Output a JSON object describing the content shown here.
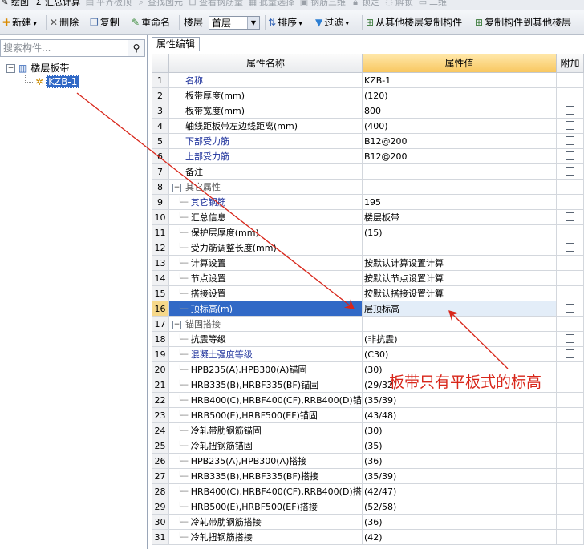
{
  "menu_bar": {
    "items": [
      {
        "icon": "paint-icon",
        "label": "绘图",
        "enabled": true
      },
      {
        "icon": "sigma-icon",
        "label": "汇总计算",
        "enabled": true
      },
      {
        "icon": "align-icon",
        "label": "平齐板顶",
        "enabled": false
      },
      {
        "icon": "find-icon",
        "label": "查找图元",
        "enabled": false
      },
      {
        "icon": "rebar-icon",
        "label": "查看钢筋量",
        "enabled": false
      },
      {
        "icon": "batch-icon",
        "label": "批量选择",
        "enabled": false
      },
      {
        "icon": "3d-icon",
        "label": "钢筋三维",
        "enabled": false
      },
      {
        "icon": "lock-icon",
        "label": "锁定",
        "enabled": false
      },
      {
        "icon": "unlock-icon",
        "label": "解锁",
        "enabled": false
      },
      {
        "icon": "view-icon",
        "label": "二维",
        "enabled": false
      }
    ]
  },
  "toolbar": {
    "new_label": "新建",
    "delete_label": "删除",
    "copy_label": "复制",
    "rename_label": "重命名",
    "floor_label": "楼层",
    "floor_value": "首层",
    "sort_label": "排序",
    "filter_label": "过滤",
    "copy_from_floor_label": "从其他楼层复制构件",
    "copy_to_floor_label": "复制构件到其他楼层"
  },
  "left_panel": {
    "search_placeholder": "搜索构件...",
    "tree_root_label": "楼层板带",
    "tree_child_label": "KZB-1"
  },
  "tab": {
    "label": "属性编辑"
  },
  "grid": {
    "headers": {
      "name": "属性名称",
      "value": "属性值",
      "extra": "附加"
    },
    "rows": [
      {
        "num": "1",
        "name": "名称",
        "value": "KZB-1",
        "style": "blue",
        "indent": 0,
        "checkbox": false
      },
      {
        "num": "2",
        "name": "板带厚度(mm)",
        "value": "(120)",
        "style": "normal",
        "indent": 0,
        "checkbox": true
      },
      {
        "num": "3",
        "name": "板带宽度(mm)",
        "value": "800",
        "style": "normal",
        "indent": 0,
        "checkbox": true
      },
      {
        "num": "4",
        "name": "轴线距板带左边线距离(mm)",
        "value": "(400)",
        "style": "normal",
        "indent": 0,
        "checkbox": true
      },
      {
        "num": "5",
        "name": "下部受力筋",
        "value": "B12@200",
        "style": "blue",
        "indent": 0,
        "checkbox": true
      },
      {
        "num": "6",
        "name": "上部受力筋",
        "value": "B12@200",
        "style": "blue",
        "indent": 0,
        "checkbox": true
      },
      {
        "num": "7",
        "name": "备注",
        "value": "",
        "style": "normal",
        "indent": 0,
        "checkbox": true
      },
      {
        "num": "8",
        "name": "其它属性",
        "value": "",
        "style": "group",
        "indent": 0,
        "checkbox": false
      },
      {
        "num": "9",
        "name": "其它钢筋",
        "value": "195",
        "style": "blue",
        "indent": 1,
        "checkbox": false
      },
      {
        "num": "10",
        "name": "汇总信息",
        "value": "楼层板带",
        "style": "normal",
        "indent": 1,
        "checkbox": true
      },
      {
        "num": "11",
        "name": "保护层厚度(mm)",
        "value": "(15)",
        "style": "normal",
        "indent": 1,
        "checkbox": true
      },
      {
        "num": "12",
        "name": "受力筋调整长度(mm)",
        "value": "",
        "style": "normal",
        "indent": 1,
        "checkbox": true
      },
      {
        "num": "13",
        "name": "计算设置",
        "value": "按默认计算设置计算",
        "style": "normal",
        "indent": 1,
        "checkbox": false
      },
      {
        "num": "14",
        "name": "节点设置",
        "value": "按默认节点设置计算",
        "style": "normal",
        "indent": 1,
        "checkbox": false
      },
      {
        "num": "15",
        "name": "搭接设置",
        "value": "按默认搭接设置计算",
        "style": "normal",
        "indent": 1,
        "checkbox": false
      },
      {
        "num": "16",
        "name": "顶标高(m)",
        "value": "层顶标高",
        "style": "selected",
        "indent": 1,
        "checkbox": true
      },
      {
        "num": "17",
        "name": "锚固搭接",
        "value": "",
        "style": "group",
        "indent": 0,
        "checkbox": false
      },
      {
        "num": "18",
        "name": "抗震等级",
        "value": "(非抗震)",
        "style": "normal",
        "indent": 1,
        "checkbox": true
      },
      {
        "num": "19",
        "name": "混凝土强度等级",
        "value": "(C30)",
        "style": "blue",
        "indent": 1,
        "checkbox": true
      },
      {
        "num": "20",
        "name": "HPB235(A),HPB300(A)锚固",
        "value": "(30)",
        "style": "normal",
        "indent": 1,
        "checkbox": false
      },
      {
        "num": "21",
        "name": "HRB335(B),HRBF335(BF)锚固",
        "value": "(29/32)",
        "style": "normal",
        "indent": 1,
        "checkbox": false
      },
      {
        "num": "22",
        "name": "HRB400(C),HRBF400(CF),RRB400(D)锚",
        "value": "(35/39)",
        "style": "normal",
        "indent": 1,
        "checkbox": false
      },
      {
        "num": "23",
        "name": "HRB500(E),HRBF500(EF)锚固",
        "value": "(43/48)",
        "style": "normal",
        "indent": 1,
        "checkbox": false
      },
      {
        "num": "24",
        "name": "冷轧带肋钢筋锚固",
        "value": "(30)",
        "style": "normal",
        "indent": 1,
        "checkbox": false
      },
      {
        "num": "25",
        "name": "冷轧扭钢筋锚固",
        "value": "(35)",
        "style": "normal",
        "indent": 1,
        "checkbox": false
      },
      {
        "num": "26",
        "name": "HPB235(A),HPB300(A)搭接",
        "value": "(36)",
        "style": "normal",
        "indent": 1,
        "checkbox": false
      },
      {
        "num": "27",
        "name": "HRB335(B),HRBF335(BF)搭接",
        "value": "(35/39)",
        "style": "normal",
        "indent": 1,
        "checkbox": false
      },
      {
        "num": "28",
        "name": "HRB400(C),HRBF400(CF),RRB400(D)搭",
        "value": "(42/47)",
        "style": "normal",
        "indent": 1,
        "checkbox": false
      },
      {
        "num": "29",
        "name": "HRB500(E),HRBF500(EF)搭接",
        "value": "(52/58)",
        "style": "normal",
        "indent": 1,
        "checkbox": false
      },
      {
        "num": "30",
        "name": "冷轧带肋钢筋搭接",
        "value": "(36)",
        "style": "normal",
        "indent": 1,
        "checkbox": false
      },
      {
        "num": "31",
        "name": "冷轧扭钢筋搭接",
        "value": "(42)",
        "style": "normal",
        "indent": 1,
        "checkbox": false
      }
    ]
  },
  "annotation": {
    "text": "板带只有平板式的标高",
    "color": "#d8261a"
  },
  "colors": {
    "selection": "#3169c6",
    "header_value_bg": "#f8c760",
    "blue_text": "#1a2e9a"
  }
}
